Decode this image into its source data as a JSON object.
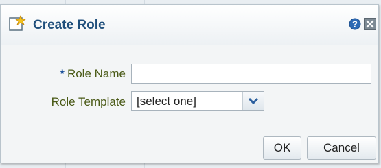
{
  "dialog": {
    "title": "Create Role",
    "title_icon": "create-role-icon",
    "help_icon": "help-icon",
    "close_icon": "close-icon"
  },
  "form": {
    "role_name": {
      "required_marker": "*",
      "label": "Role Name",
      "value": ""
    },
    "role_template": {
      "label": "Role Template",
      "selected": "[select one]"
    }
  },
  "buttons": {
    "ok": "OK",
    "cancel": "Cancel"
  },
  "colors": {
    "title": "#1f4f7c",
    "label": "#4a5a17",
    "required": "#1a4f9a"
  }
}
